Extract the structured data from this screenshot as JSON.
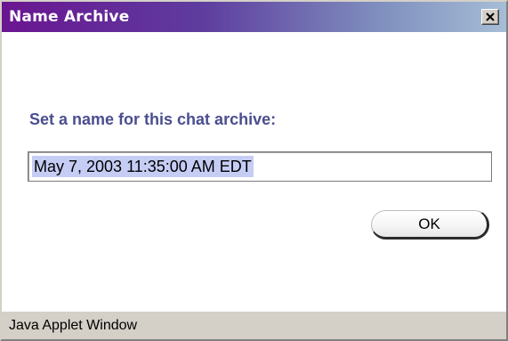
{
  "window": {
    "title": "Name Archive"
  },
  "dialog": {
    "prompt": "Set a name for this chat archive:",
    "archive_name_value": "May 7, 2003 11:35:00 AM EDT",
    "ok_label": "OK"
  },
  "statusbar": {
    "text": "Java Applet Window"
  },
  "icons": {
    "close": "close-icon"
  },
  "colors": {
    "titlebar_start": "#6a1591",
    "titlebar_end": "#a6bdd6",
    "prompt_text": "#4a4e8f",
    "selection_highlight": "#c5cdf5",
    "statusbar_bg": "#d4d0c8"
  }
}
